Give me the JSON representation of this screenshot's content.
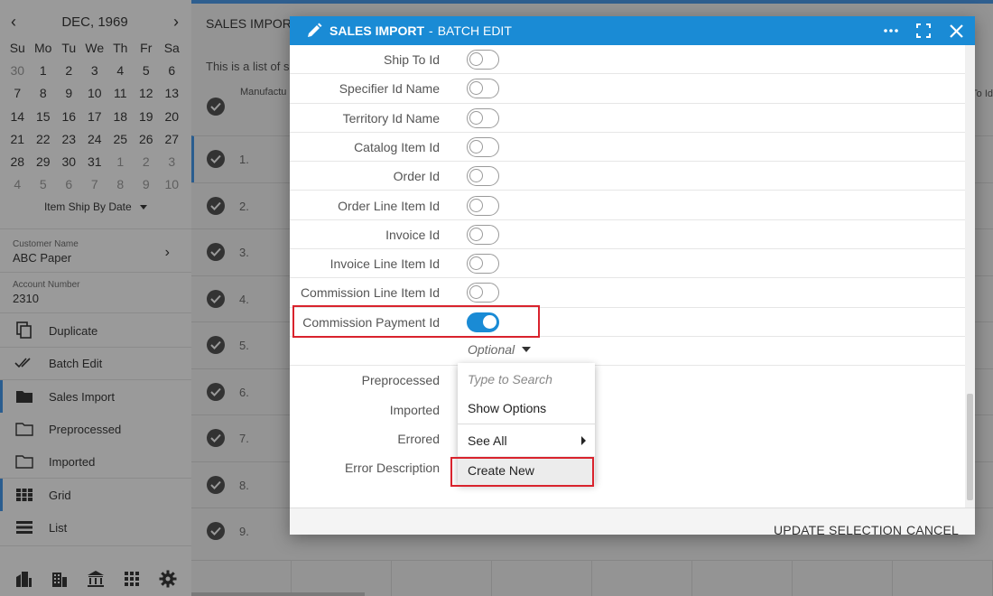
{
  "calendar": {
    "month_label": "DEC, 1969",
    "weekdays": [
      "Su",
      "Mo",
      "Tu",
      "We",
      "Th",
      "Fr",
      "Sa"
    ],
    "weeks": [
      [
        "30",
        "1",
        "2",
        "3",
        "4",
        "5",
        "6"
      ],
      [
        "7",
        "8",
        "9",
        "10",
        "11",
        "12",
        "13"
      ],
      [
        "14",
        "15",
        "16",
        "17",
        "18",
        "19",
        "20"
      ],
      [
        "21",
        "22",
        "23",
        "24",
        "25",
        "26",
        "27"
      ],
      [
        "28",
        "29",
        "30",
        "31",
        "1",
        "2",
        "3"
      ],
      [
        "4",
        "5",
        "6",
        "7",
        "8",
        "9",
        "10"
      ]
    ],
    "sort_label": "Item Ship By Date"
  },
  "sidebar": {
    "customer_label": "Customer Name",
    "customer_value": "ABC Paper",
    "account_label": "Account Number",
    "account_value": "2310",
    "actions": [
      {
        "label": "Duplicate",
        "icon": "copy-icon"
      },
      {
        "label": "Batch Edit",
        "icon": "double-check-icon"
      },
      {
        "label": "Sales Import",
        "icon": "folder-filled-icon"
      },
      {
        "label": "Preprocessed",
        "icon": "folder-icon"
      },
      {
        "label": "Imported",
        "icon": "folder-icon"
      },
      {
        "label": "Grid",
        "icon": "grid-icon"
      },
      {
        "label": "List",
        "icon": "list-icon"
      }
    ]
  },
  "main": {
    "title": "SALES IMPORT",
    "description": "This is a list of s",
    "column_header": "Manufactu",
    "column_header_right": "To Id",
    "rows": [
      "1.",
      "2.",
      "3.",
      "4.",
      "5.",
      "6.",
      "7.",
      "8.",
      "9."
    ]
  },
  "modal": {
    "title_bold": "SALES IMPORT",
    "title_sep": "-",
    "title_rest": "BATCH EDIT",
    "toggles": [
      {
        "label": "Ship To Id",
        "on": false
      },
      {
        "label": "Specifier Id Name",
        "on": false
      },
      {
        "label": "Territory Id Name",
        "on": false
      },
      {
        "label": "Catalog Item Id",
        "on": false
      },
      {
        "label": "Order Id",
        "on": false
      },
      {
        "label": "Order Line Item Id",
        "on": false
      },
      {
        "label": "Invoice Id",
        "on": false
      },
      {
        "label": "Invoice Line Item Id",
        "on": false
      },
      {
        "label": "Commission Line Item Id",
        "on": false
      },
      {
        "label": "Commission Payment Id",
        "on": true
      }
    ],
    "optional_value": "Optional",
    "status_fields": [
      "Preprocessed",
      "Imported",
      "Errored",
      "Error Description"
    ],
    "dropdown": {
      "search_placeholder": "Type to Search",
      "show_options": "Show Options",
      "see_all": "See All",
      "create_new": "Create New"
    },
    "update_button": "UPDATE SELECTION",
    "cancel_button": "CANCEL"
  },
  "colors": {
    "accent": "#1a8bd5",
    "highlight": "#d9232d"
  }
}
